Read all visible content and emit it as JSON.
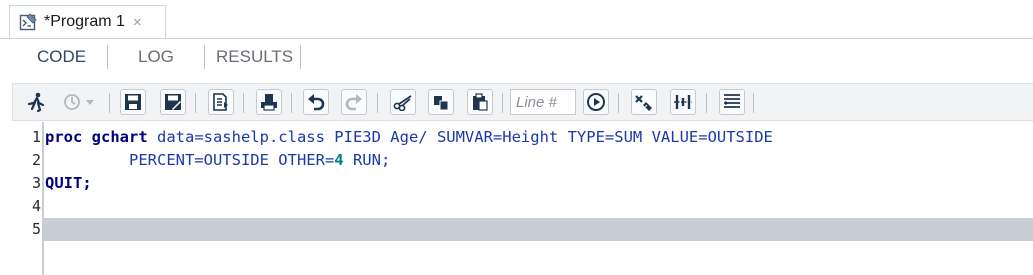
{
  "window": {
    "tab_title": "*Program 1",
    "tab_close": "×"
  },
  "subtabs": {
    "code": "CODE",
    "log": "LOG",
    "results": "RESULTS"
  },
  "toolbar": {
    "line_input_placeholder": "Line #",
    "icons": [
      "run-icon",
      "history-icon",
      "save-icon",
      "save-as-icon",
      "export-icon",
      "print-icon",
      "undo-icon",
      "redo-icon",
      "cut-icon",
      "copy-icon",
      "paste-icon",
      "go-icon",
      "clear-icon",
      "format-icon",
      "outline-icon"
    ]
  },
  "editor": {
    "line_numbers": [
      "1",
      "2",
      "3",
      "4",
      "5"
    ],
    "current_line": 5,
    "lines": [
      [
        {
          "t": "proc gchart",
          "c": "kw"
        },
        {
          "t": " data=sashelp.class PIE3D Age/ SUMVAR=Height TYPE=SUM VALUE=OUTSIDE",
          "c": "opt"
        }
      ],
      [
        {
          "t": "         PERCENT=OUTSIDE OTHER=",
          "c": "opt"
        },
        {
          "t": "4",
          "c": "num"
        },
        {
          "t": " RUN;",
          "c": "opt"
        }
      ],
      [
        {
          "t": "QUIT;",
          "c": "kw"
        }
      ],
      [],
      []
    ]
  },
  "colors": {
    "accent": "#2f4864",
    "current_line_bg": "#c9ced6",
    "keyword": "#000080",
    "option": "#1b3aa8",
    "number": "#008080"
  }
}
